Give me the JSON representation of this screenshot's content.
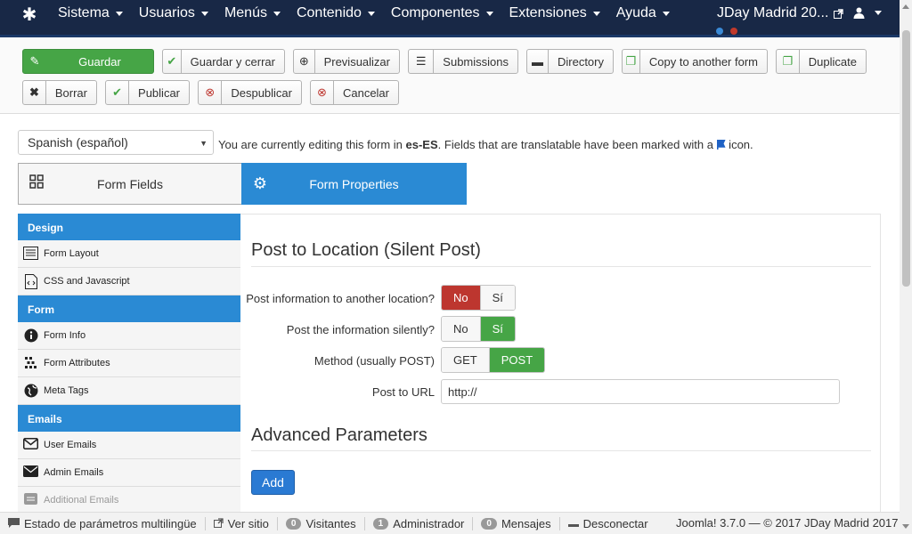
{
  "navbar": {
    "menu": [
      "Sistema",
      "Usuarios",
      "Menús",
      "Contenido",
      "Componentes",
      "Extensiones",
      "Ayuda"
    ],
    "site_name": "JDay Madrid 20...",
    "dot_colors": [
      "#3a8ad6",
      "#c0392b"
    ]
  },
  "toolbar": {
    "row1": [
      {
        "label": "Guardar",
        "icon": "edit-icon",
        "style": "success"
      },
      {
        "label": "Guardar y cerrar",
        "icon": "check-icon"
      },
      {
        "label": "Previsualizar",
        "icon": "plus-circle-icon"
      },
      {
        "label": "Submissions",
        "icon": "database-icon"
      },
      {
        "label": "Directory",
        "icon": "folder-icon"
      },
      {
        "label": "Copy to another form",
        "icon": "copy-icon"
      },
      {
        "label": "Duplicate",
        "icon": "copy-icon"
      }
    ],
    "row2": [
      {
        "label": "Borrar",
        "icon": "x-icon"
      },
      {
        "label": "Publicar",
        "icon": "check-icon"
      },
      {
        "label": "Despublicar",
        "icon": "x-circle-icon"
      },
      {
        "label": "Cancelar",
        "icon": "x-circle-icon"
      }
    ]
  },
  "language": {
    "selected": "Spanish (español)",
    "note_prefix": "You are currently editing this form in ",
    "note_lang": "es-ES",
    "note_suffix": ". Fields that are translatable have been marked with a ",
    "note_end": " icon."
  },
  "tabs": [
    {
      "label": "Form Fields",
      "active": false
    },
    {
      "label": "Form Properties",
      "active": true
    }
  ],
  "sidebar": {
    "sections": [
      {
        "title": "Design",
        "items": [
          {
            "label": "Form Layout",
            "icon": "layout-icon"
          },
          {
            "label": "CSS and Javascript",
            "icon": "code-file-icon"
          }
        ]
      },
      {
        "title": "Form",
        "items": [
          {
            "label": "Form Info",
            "icon": "info-icon"
          },
          {
            "label": "Form Attributes",
            "icon": "attributes-icon"
          },
          {
            "label": "Meta Tags",
            "icon": "globe-icon"
          }
        ]
      },
      {
        "title": "Emails",
        "items": [
          {
            "label": "User Emails",
            "icon": "envelope-outline-icon"
          },
          {
            "label": "Admin Emails",
            "icon": "envelope-icon"
          },
          {
            "label": "Additional Emails",
            "icon": "envelope-icon"
          }
        ]
      }
    ]
  },
  "main": {
    "title": "Post to Location (Silent Post)",
    "rows": [
      {
        "label": "Post information to another location?",
        "options": [
          "No",
          "Sí"
        ],
        "selected": "No"
      },
      {
        "label": "Post the information silently?",
        "options": [
          "No",
          "Sí"
        ],
        "selected": "Sí"
      },
      {
        "label": "Method (usually POST)",
        "options": [
          "GET",
          "POST"
        ],
        "selected": "POST"
      }
    ],
    "url_label": "Post to URL",
    "url_value": "http://",
    "advanced_title": "Advanced Parameters",
    "add_label": "Add"
  },
  "statusbar": {
    "multilang": "Estado de parámetros multilingüe",
    "view_site": "Ver sitio",
    "visitors_count": "0",
    "visitors": "Visitantes",
    "admin_count": "1",
    "admin": "Administrador",
    "messages_count": "0",
    "messages": "Mensajes",
    "logout": "Desconectar",
    "footer": "Joomla! 3.7.0 — © 2017 JDay Madrid 2017"
  }
}
